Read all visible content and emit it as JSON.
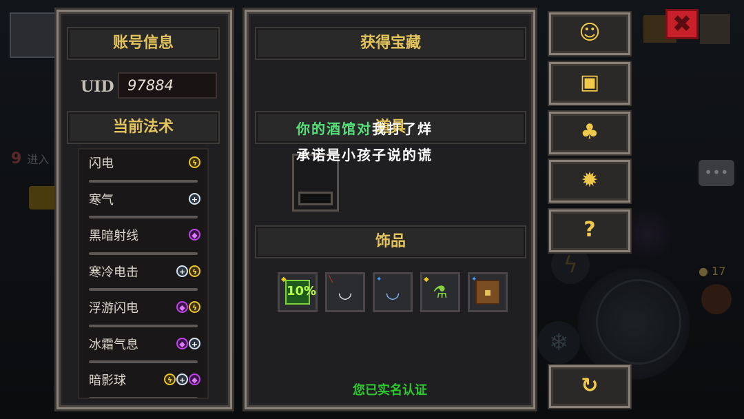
{
  "account_panel": {
    "title": "账号信息",
    "uid_label": "UID",
    "uid_value": "97884",
    "spells_title": "当前法术",
    "spells": [
      {
        "name": "闪电",
        "elements": [
          "lightning"
        ]
      },
      {
        "name": "寒气",
        "elements": [
          "frost"
        ]
      },
      {
        "name": "黑暗射线",
        "elements": [
          "dark"
        ]
      },
      {
        "name": "寒冷电击",
        "elements": [
          "frost",
          "lightning"
        ]
      },
      {
        "name": "浮游闪电",
        "elements": [
          "dark",
          "lightning"
        ]
      },
      {
        "name": "冰霜气息",
        "elements": [
          "dark",
          "frost"
        ]
      },
      {
        "name": "暗影球",
        "elements": [
          "lightning",
          "frost",
          "dark"
        ]
      }
    ]
  },
  "treasure_panel": {
    "title": "获得宝藏",
    "section2_title": "道具",
    "overlay_line1_green": "你的酒馆对",
    "overlay_line1_white": "我打了烊",
    "overlay_line2": "承诺是小孩子说的谎",
    "accessories_title": "饰品",
    "accessories": [
      {
        "name": "book",
        "icon": "green-book-icon",
        "label": "10%"
      },
      {
        "name": "necklace-red",
        "icon": "necklace-icon"
      },
      {
        "name": "necklace-blue",
        "icon": "necklace-icon"
      },
      {
        "name": "potion",
        "icon": "potion-icon"
      },
      {
        "name": "scroll",
        "icon": "scroll-icon"
      }
    ],
    "verified_text": "您已实名认证"
  },
  "side_buttons": [
    {
      "name": "support",
      "icon": "headset-icon",
      "glyph": "☺"
    },
    {
      "name": "gift",
      "icon": "gift-icon",
      "glyph": "▣"
    },
    {
      "name": "bee",
      "icon": "bee-icon",
      "glyph": "♣"
    },
    {
      "name": "settings",
      "icon": "gear-icon",
      "glyph": "✹"
    },
    {
      "name": "help",
      "icon": "help-book-icon",
      "glyph": "?"
    },
    {
      "name": "refresh",
      "icon": "refresh-icon",
      "glyph": "↻"
    }
  ],
  "close_glyph": "✖",
  "colors": {
    "title_gold": "#e2c35c",
    "verified_green": "#2ec82e",
    "overlay_green": "#56e07a",
    "lightning": "#e8c52a",
    "frost": "#d4e2ee",
    "dark": "#c043ea"
  }
}
